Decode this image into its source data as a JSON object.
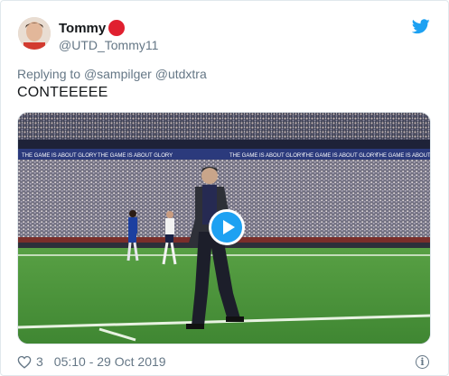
{
  "tweet": {
    "author_name": "Tommy",
    "author_handle": "@UTD_Tommy11",
    "reply_prefix": "Replying to",
    "reply_to": [
      "@sampilger",
      "@utdxtra"
    ],
    "text": "CONTEEEEE",
    "banner_text": "THE GAME IS ABOUT GLORY",
    "likes": "3",
    "timestamp": "05:10 - 29 Oct 2019"
  },
  "icons": {
    "brand": "twitter-bird-icon",
    "badge": "red-circle-emoji",
    "play": "play-icon",
    "like": "heart-icon",
    "info": "info-icon"
  },
  "colors": {
    "twitter_blue": "#1da1f2",
    "text_primary": "#14171a",
    "text_secondary": "#657786",
    "pitch_green": "#4a8f3a",
    "badge_red": "#e0202f"
  }
}
